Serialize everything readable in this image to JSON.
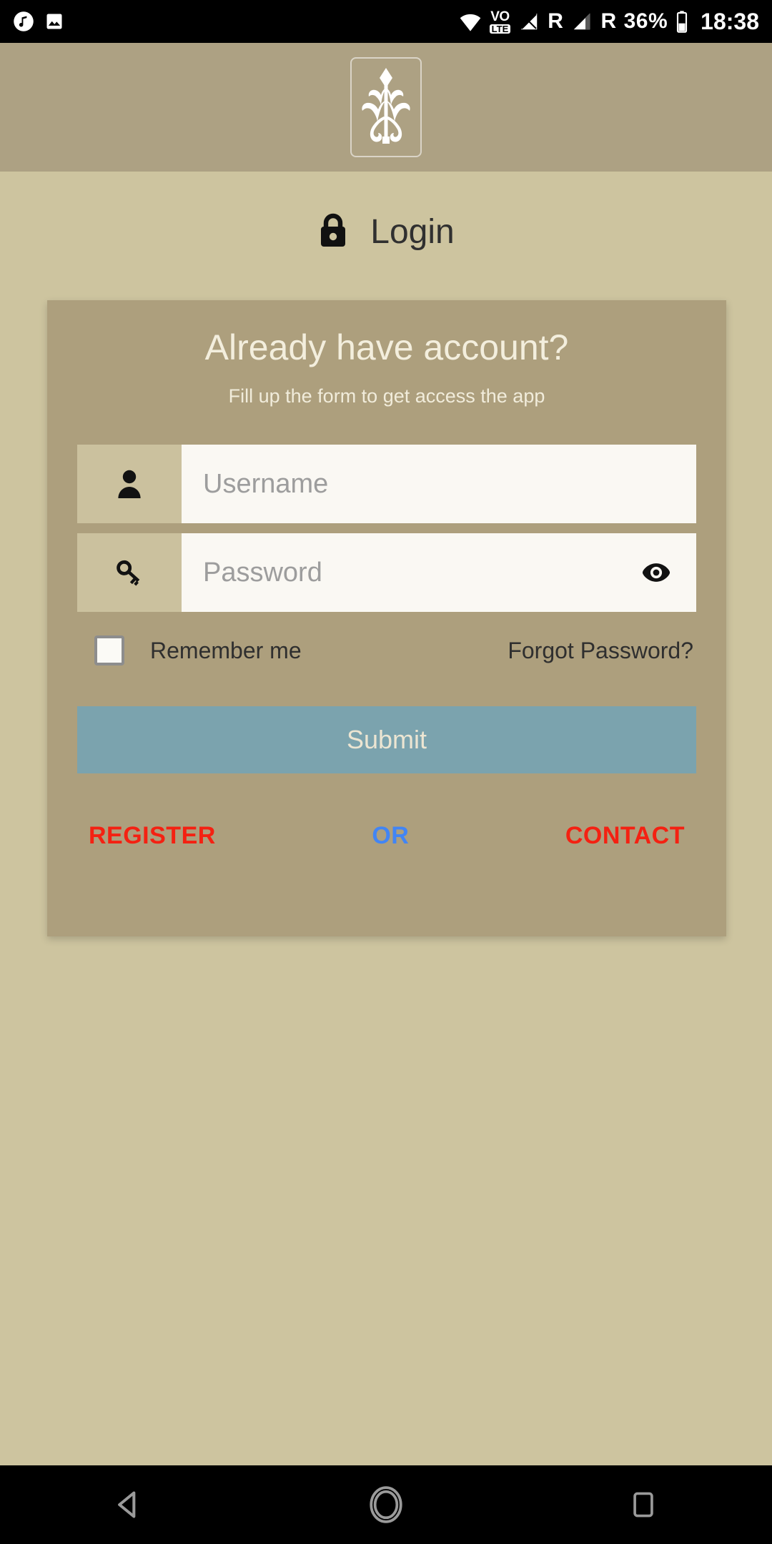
{
  "statusbar": {
    "left_icons": [
      "music-note-icon",
      "image-icon"
    ],
    "right_icons": [
      "wifi-icon",
      "volte-icon",
      "signal-1-icon",
      "signal-2-icon",
      "battery-icon"
    ],
    "volte_top": "VO",
    "volte_bottom": "LTE",
    "roaming_1": "R",
    "roaming_2": "R",
    "battery": "36%",
    "time": "18:38"
  },
  "header": {
    "logo_name": "app-crest-logo"
  },
  "page": {
    "title": "Login",
    "lock_icon": "lock-icon"
  },
  "card": {
    "heading": "Already have account?",
    "subtitle": "Fill up the form to get access the app",
    "username": {
      "icon": "user-icon",
      "placeholder": "Username",
      "value": ""
    },
    "password": {
      "icon": "key-icon",
      "placeholder": "Password",
      "value": "",
      "toggle_icon": "eye-icon"
    },
    "remember": {
      "label": "Remember me",
      "checked": false
    },
    "forgot_label": "Forgot Password?",
    "submit_label": "Submit",
    "links": {
      "register": "REGISTER",
      "or": "OR",
      "contact": "CONTACT"
    }
  },
  "navbar": {
    "back": "back-icon",
    "home": "home-icon",
    "recents": "recents-icon"
  },
  "colors": {
    "page_bg": "#cdc49f",
    "header_bg": "#ada183",
    "card_bg": "#ad9f7d",
    "field_bg": "#faf8f3",
    "field_icon_bg": "#cbc19e",
    "submit_bg": "#7ba3ae",
    "link_red": "#f42112",
    "link_blue": "#4285f4"
  }
}
